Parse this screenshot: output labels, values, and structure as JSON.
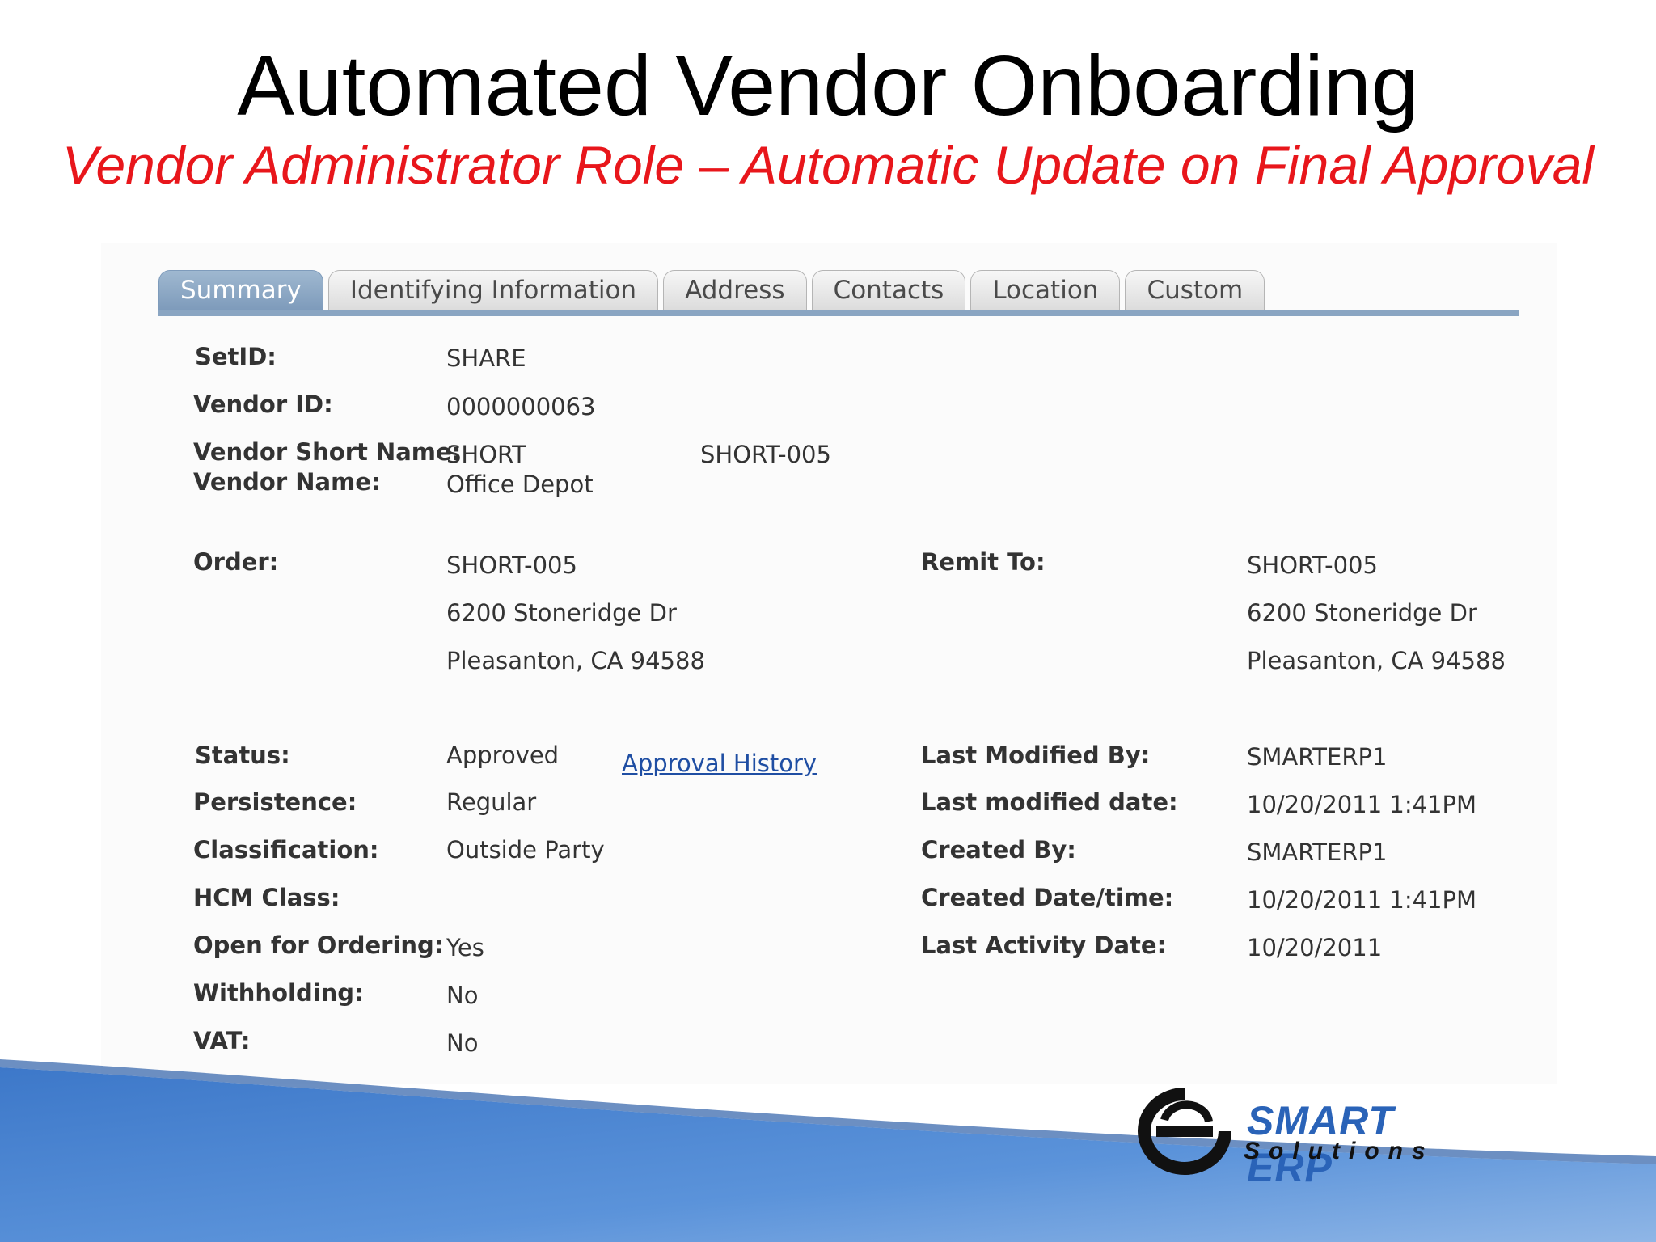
{
  "slide": {
    "title": "Automated Vendor Onboarding",
    "subtitle": "Vendor Administrator Role – Automatic Update on Final Approval"
  },
  "tabs": [
    {
      "label": "Summary",
      "active": true
    },
    {
      "label": "Identifying Information",
      "active": false
    },
    {
      "label": "Address",
      "active": false
    },
    {
      "label": "Contacts",
      "active": false
    },
    {
      "label": "Location",
      "active": false
    },
    {
      "label": "Custom",
      "active": false
    }
  ],
  "summary": {
    "setid_label": "SetID:",
    "setid_value": "SHARE",
    "vendor_id_label": "Vendor ID:",
    "vendor_id_value": "0000000063",
    "short_name_label": "Vendor Short Name:",
    "short_name_value": "SHORT",
    "short_name_code": "SHORT-005",
    "vendor_name_label": "Vendor Name:",
    "vendor_name_value": "Office Depot",
    "order_label": "Order:",
    "order_lines": [
      "SHORT-005",
      "6200 Stoneridge Dr",
      "Pleasanton, CA  94588"
    ],
    "remit_label": "Remit To:",
    "remit_lines": [
      "SHORT-005",
      "6200 Stoneridge Dr",
      "Pleasanton, CA  94588"
    ],
    "status_label": "Status:",
    "status_value": "Approved",
    "approval_history_link": "Approval History",
    "persistence_label": "Persistence:",
    "persistence_value": "Regular",
    "classification_label": "Classification:",
    "classification_value": "Outside Party",
    "hcm_class_label": "HCM Class:",
    "open_ordering_label": "Open for Ordering:",
    "open_ordering_value": "Yes",
    "withholding_label": "Withholding:",
    "withholding_value": "No",
    "vat_label": "VAT:",
    "vat_value": "No",
    "last_modified_by_label": "Last Modified By:",
    "last_modified_by_value": "SMARTERP1",
    "last_modified_date_label": "Last modified date:",
    "last_modified_date_value": "10/20/2011  1:41PM",
    "created_by_label": "Created By:",
    "created_by_value": "SMARTERP1",
    "created_datetime_label": "Created Date/time:",
    "created_datetime_value": "10/20/2011  1:41PM",
    "last_activity_label": "Last Activity Date:",
    "last_activity_value": "10/20/2011"
  },
  "logo": {
    "brand": "SMART ERP",
    "tagline": "Solutions"
  },
  "colors": {
    "subtitle": "#e8161b",
    "tab_active": "#8aa5c2",
    "link": "#1f4ea3",
    "swoosh": "#4d86d0"
  }
}
